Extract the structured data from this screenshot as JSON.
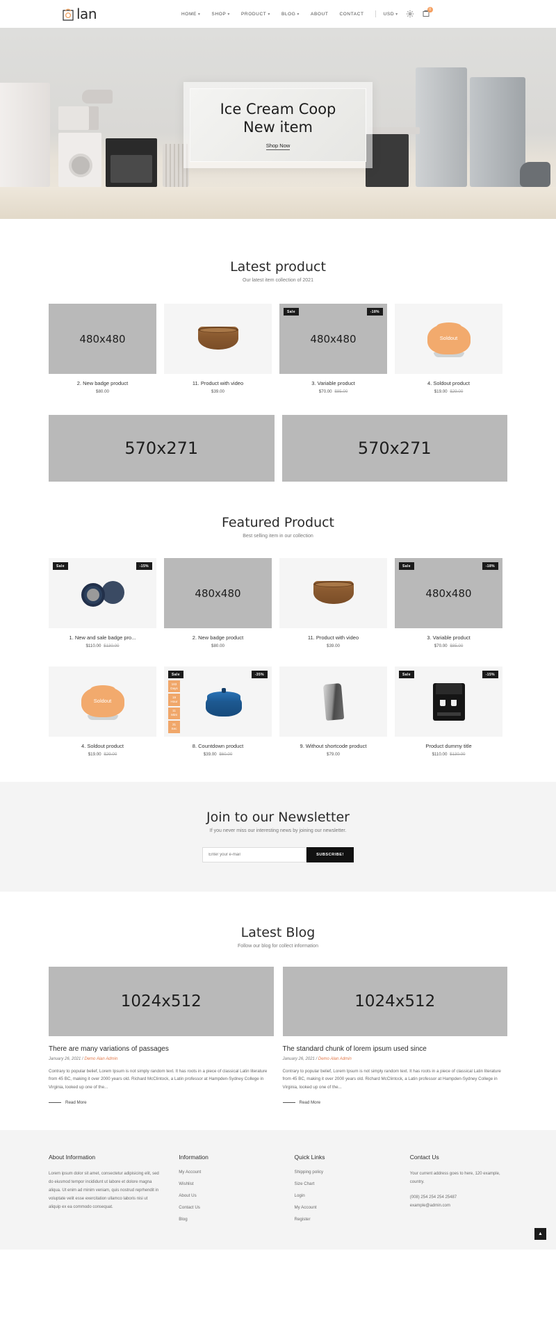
{
  "header": {
    "logo_text": "lan",
    "nav": [
      {
        "label": "HOME",
        "caret": true
      },
      {
        "label": "SHOP",
        "caret": true
      },
      {
        "label": "PRODUCT",
        "caret": true
      },
      {
        "label": "BLOG",
        "caret": true
      },
      {
        "label": "ABOUT",
        "caret": false
      },
      {
        "label": "CONTACT",
        "caret": false
      }
    ],
    "currency": "USD",
    "cart_count": "0"
  },
  "hero": {
    "title_line1": "Ice Cream Coop",
    "title_line2": "New item",
    "cta": "Shop Now"
  },
  "latest": {
    "title": "Latest product",
    "subtitle": "Our latest item collection of 2021",
    "products": [
      {
        "name": "2. New badge product",
        "price": "$80.00",
        "old_price": "",
        "placeholder": "480x480",
        "kind": "placeholder",
        "sale": "",
        "discount": ""
      },
      {
        "name": "11. Product with video",
        "price": "$39.00",
        "old_price": "",
        "placeholder": "",
        "kind": "bowl",
        "sale": "",
        "discount": ""
      },
      {
        "name": "3. Variable product",
        "price": "$70.00",
        "old_price": "$85.00",
        "placeholder": "480x480",
        "kind": "placeholder",
        "sale": "Sale",
        "discount": "-18%"
      },
      {
        "name": "4. Soldout product",
        "price": "$19.00",
        "old_price": "$29.00",
        "placeholder": "",
        "kind": "soldout",
        "sale": "",
        "discount": "",
        "overlay": "Soldout"
      }
    ]
  },
  "banners": [
    {
      "label": "570x271"
    },
    {
      "label": "570x271"
    }
  ],
  "featured": {
    "title": "Featured Product",
    "subtitle": "Best selling item in our collection",
    "products": [
      {
        "name": "1. New and sale badge pro...",
        "price": "$110.00",
        "old_price": "$130.00",
        "placeholder": "",
        "kind": "plates",
        "sale": "Sale",
        "discount": "-15%"
      },
      {
        "name": "2. New badge product",
        "price": "$80.00",
        "old_price": "",
        "placeholder": "480x480",
        "kind": "placeholder",
        "sale": "",
        "discount": ""
      },
      {
        "name": "11. Product with video",
        "price": "$39.00",
        "old_price": "",
        "placeholder": "",
        "kind": "bowl",
        "sale": "",
        "discount": ""
      },
      {
        "name": "3. Variable product",
        "price": "$70.00",
        "old_price": "$85.00",
        "placeholder": "480x480",
        "kind": "placeholder",
        "sale": "Sale",
        "discount": "-18%"
      },
      {
        "name": "4. Soldout product",
        "price": "$19.00",
        "old_price": "$29.00",
        "placeholder": "",
        "kind": "soldout",
        "sale": "",
        "discount": "",
        "overlay": "Soldout"
      },
      {
        "name": "8. Countdown product",
        "price": "$39.00",
        "old_price": "$60.00",
        "placeholder": "",
        "kind": "dutch",
        "sale": "Sale",
        "discount": "-35%",
        "countdown": [
          {
            "value": "183",
            "unit": "Days"
          },
          {
            "value": "19",
            "unit": "Hour"
          },
          {
            "value": "11",
            "unit": "Mint"
          },
          {
            "value": "31",
            "unit": "Sec"
          }
        ]
      },
      {
        "name": "9. Without shortcode product",
        "price": "$79.00",
        "old_price": "",
        "placeholder": "",
        "kind": "opener",
        "sale": "",
        "discount": ""
      },
      {
        "name": "Product dummy title",
        "price": "$110.00",
        "old_price": "$130.00",
        "placeholder": "",
        "kind": "dispenser",
        "sale": "Sale",
        "discount": "-15%"
      }
    ]
  },
  "newsletter": {
    "title": "Join to our Newsletter",
    "subtitle": "If you never miss our interesting news by joining our newsletter.",
    "placeholder": "Enter your e-mail",
    "button": "SUBSCRIBE!"
  },
  "blog": {
    "title": "Latest Blog",
    "subtitle": "Follow our blog for collect information",
    "posts": [
      {
        "thumb": "1024x512",
        "title": "There are many variations of passages",
        "date": "January 26, 2021 /",
        "author": "Demo Alan Admin",
        "excerpt": "Contrary to popular belief, Lorem Ipsum is not simply random text. It has roots in a piece of classical Latin literature from 45 BC, making it over 2000 years old. Richard McClintock, a Latin professor at Hampden-Sydney College in Virginia, looked up one of the...",
        "read_more": "Read More"
      },
      {
        "thumb": "1024x512",
        "title": "The standard chunk of lorem ipsum used since",
        "date": "January 26, 2021 /",
        "author": "Demo Alan Admin",
        "excerpt": "Contrary to popular belief, Lorem Ipsum is not simply random text. It has roots in a piece of classical Latin literature from 45 BC, making it over 2000 years old. Richard McClintock, a Latin professor at Hampden-Sydney College in Virginia, looked up one of the...",
        "read_more": "Read More"
      }
    ]
  },
  "footer": {
    "about": {
      "title": "About Information",
      "text": "Lorem ipsum dolor sit amet, consectetur adipisicing elit, sed do eiusmod tempor incididunt ut labore et dolore magna aliqua. Ut enim ad minim veniam, quis nostrud reprhendit in voluptate velit esse exercitation ullamco laboris nisi ut aliquip ex ea commodo consequat."
    },
    "information": {
      "title": "Information",
      "links": [
        "My Account",
        "Wishlist",
        "About Us",
        "Contact Us",
        "Blog"
      ]
    },
    "quick_links": {
      "title": "Quick Links",
      "links": [
        "Shipping policy",
        "Size Chart",
        "Login",
        "My Account",
        "Register"
      ]
    },
    "contact": {
      "title": "Contact Us",
      "address": "Your current address goes to here, 120 example, country.",
      "phone": "(008) 254 254 254 25487",
      "email": "example@admin.com"
    },
    "to_top": "▲"
  }
}
